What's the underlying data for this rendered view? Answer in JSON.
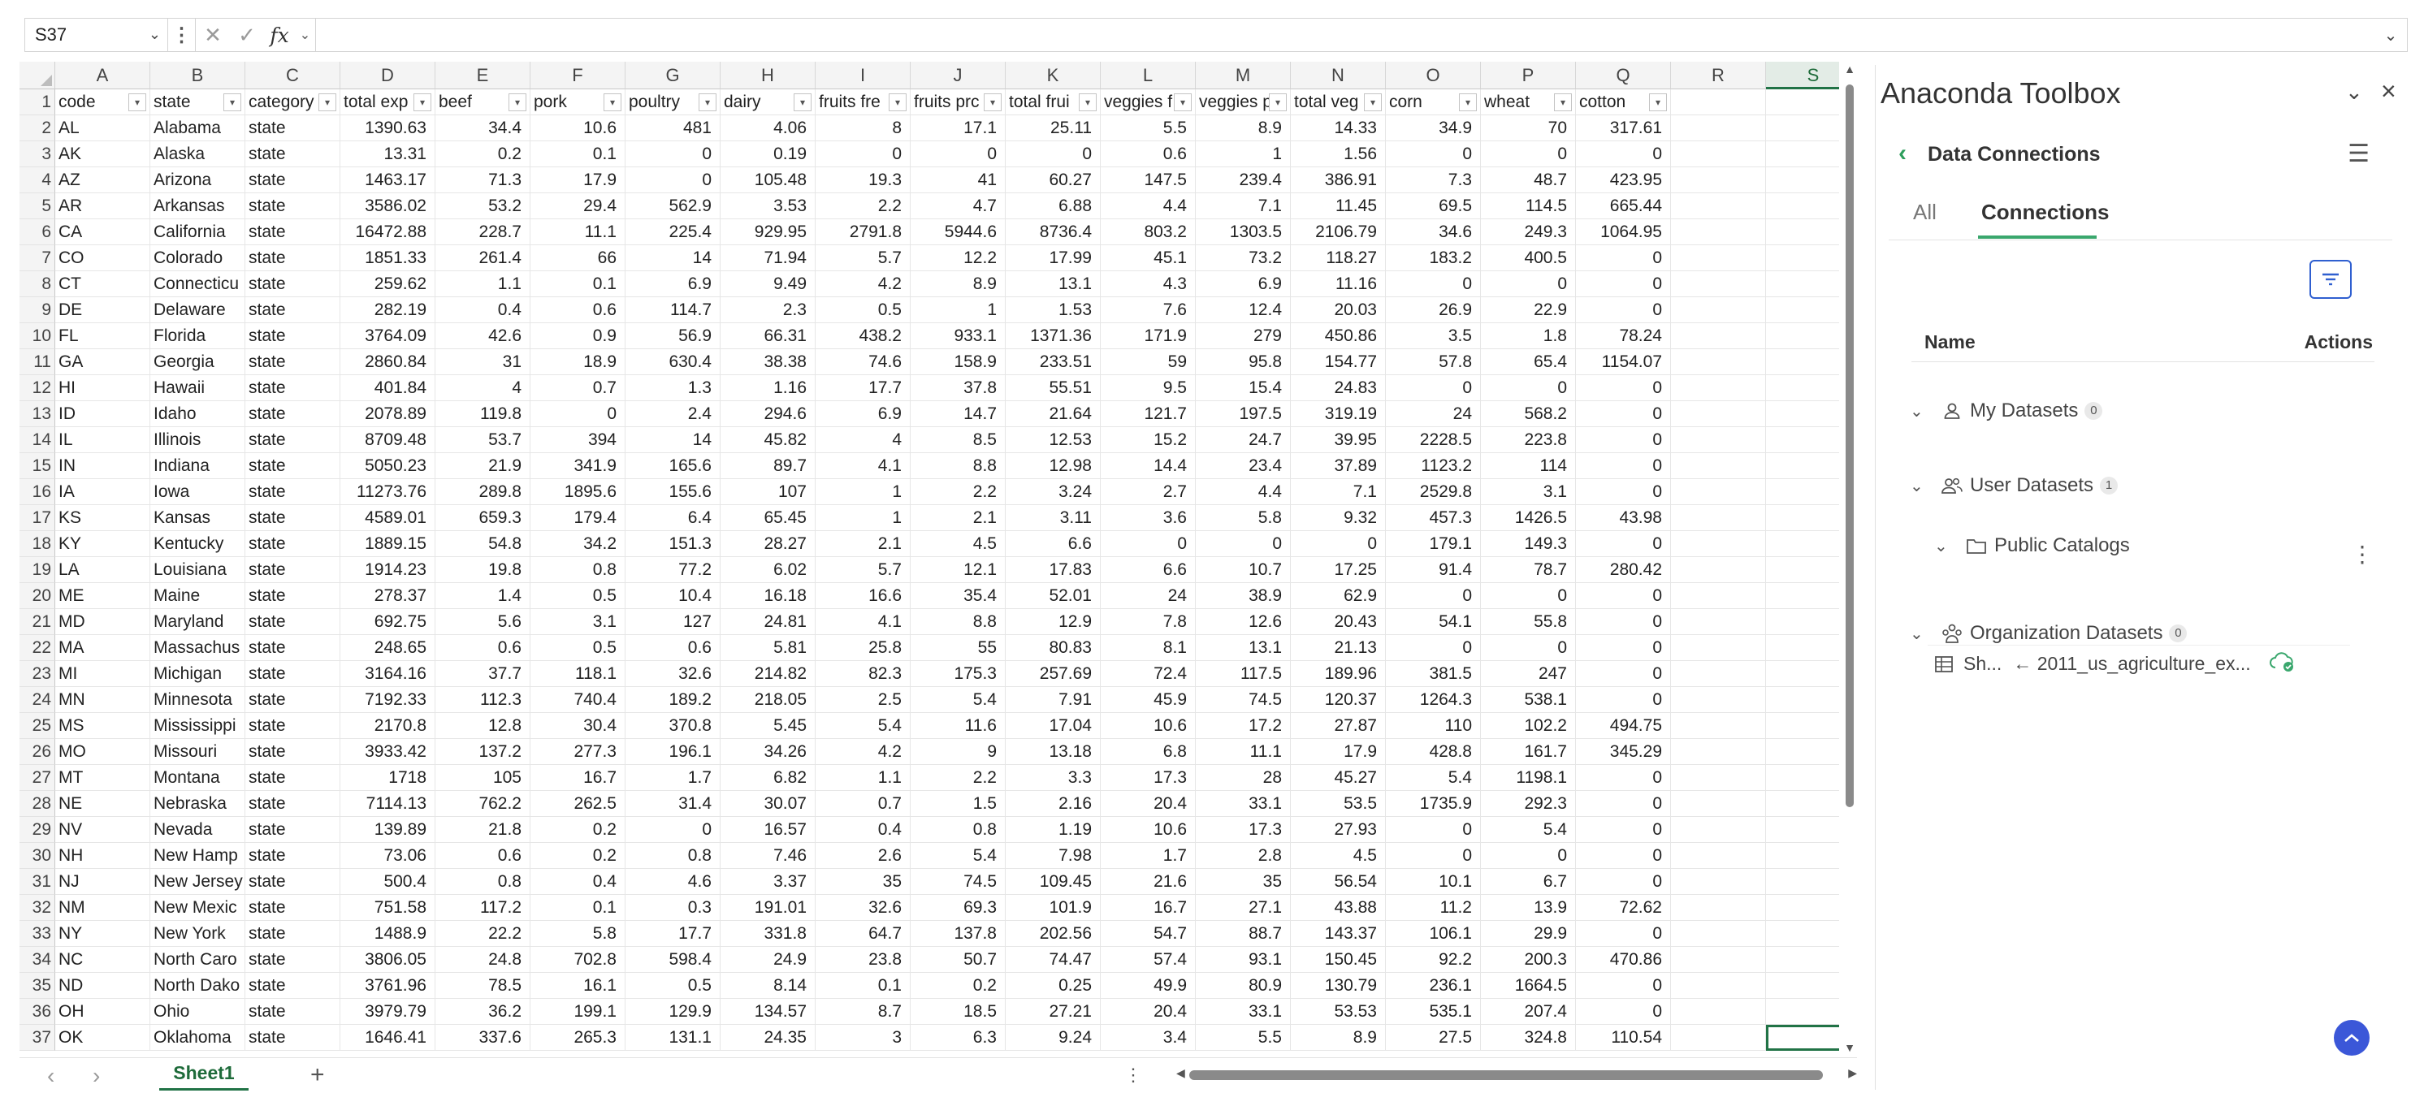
{
  "formula_bar": {
    "name_box": "S37",
    "fx": "fx",
    "content": ""
  },
  "spreadsheet": {
    "column_letters": [
      "A",
      "B",
      "C",
      "D",
      "E",
      "F",
      "G",
      "H",
      "I",
      "J",
      "K",
      "L",
      "M",
      "N",
      "O",
      "P",
      "Q",
      "R",
      "S"
    ],
    "selected_column": "S",
    "selected_cell": "S37",
    "headers": [
      "code",
      "state",
      "category",
      "total exp",
      "beef",
      "pork",
      "poultry",
      "dairy",
      "fruits fre",
      "fruits prc",
      "total frui",
      "veggies f",
      "veggies p",
      "total veg",
      "corn",
      "wheat",
      "cotton"
    ],
    "rows": [
      [
        "2",
        "AL",
        "Alabama",
        "state",
        "1390.63",
        "34.4",
        "10.6",
        "481",
        "4.06",
        "8",
        "17.1",
        "25.11",
        "5.5",
        "8.9",
        "14.33",
        "34.9",
        "70",
        "317.61"
      ],
      [
        "3",
        "AK",
        "Alaska",
        "state",
        "13.31",
        "0.2",
        "0.1",
        "0",
        "0.19",
        "0",
        "0",
        "0",
        "0.6",
        "1",
        "1.56",
        "0",
        "0",
        "0"
      ],
      [
        "4",
        "AZ",
        "Arizona",
        "state",
        "1463.17",
        "71.3",
        "17.9",
        "0",
        "105.48",
        "19.3",
        "41",
        "60.27",
        "147.5",
        "239.4",
        "386.91",
        "7.3",
        "48.7",
        "423.95"
      ],
      [
        "5",
        "AR",
        "Arkansas",
        "state",
        "3586.02",
        "53.2",
        "29.4",
        "562.9",
        "3.53",
        "2.2",
        "4.7",
        "6.88",
        "4.4",
        "7.1",
        "11.45",
        "69.5",
        "114.5",
        "665.44"
      ],
      [
        "6",
        "CA",
        "California",
        "state",
        "16472.88",
        "228.7",
        "11.1",
        "225.4",
        "929.95",
        "2791.8",
        "5944.6",
        "8736.4",
        "803.2",
        "1303.5",
        "2106.79",
        "34.6",
        "249.3",
        "1064.95"
      ],
      [
        "7",
        "CO",
        "Colorado",
        "state",
        "1851.33",
        "261.4",
        "66",
        "14",
        "71.94",
        "5.7",
        "12.2",
        "17.99",
        "45.1",
        "73.2",
        "118.27",
        "183.2",
        "400.5",
        "0"
      ],
      [
        "8",
        "CT",
        "Connecticu",
        "state",
        "259.62",
        "1.1",
        "0.1",
        "6.9",
        "9.49",
        "4.2",
        "8.9",
        "13.1",
        "4.3",
        "6.9",
        "11.16",
        "0",
        "0",
        "0"
      ],
      [
        "9",
        "DE",
        "Delaware",
        "state",
        "282.19",
        "0.4",
        "0.6",
        "114.7",
        "2.3",
        "0.5",
        "1",
        "1.53",
        "7.6",
        "12.4",
        "20.03",
        "26.9",
        "22.9",
        "0"
      ],
      [
        "10",
        "FL",
        "Florida",
        "state",
        "3764.09",
        "42.6",
        "0.9",
        "56.9",
        "66.31",
        "438.2",
        "933.1",
        "1371.36",
        "171.9",
        "279",
        "450.86",
        "3.5",
        "1.8",
        "78.24"
      ],
      [
        "11",
        "GA",
        "Georgia",
        "state",
        "2860.84",
        "31",
        "18.9",
        "630.4",
        "38.38",
        "74.6",
        "158.9",
        "233.51",
        "59",
        "95.8",
        "154.77",
        "57.8",
        "65.4",
        "1154.07"
      ],
      [
        "12",
        "HI",
        "Hawaii",
        "state",
        "401.84",
        "4",
        "0.7",
        "1.3",
        "1.16",
        "17.7",
        "37.8",
        "55.51",
        "9.5",
        "15.4",
        "24.83",
        "0",
        "0",
        "0"
      ],
      [
        "13",
        "ID",
        "Idaho",
        "state",
        "2078.89",
        "119.8",
        "0",
        "2.4",
        "294.6",
        "6.9",
        "14.7",
        "21.64",
        "121.7",
        "197.5",
        "319.19",
        "24",
        "568.2",
        "0"
      ],
      [
        "14",
        "IL",
        "Illinois",
        "state",
        "8709.48",
        "53.7",
        "394",
        "14",
        "45.82",
        "4",
        "8.5",
        "12.53",
        "15.2",
        "24.7",
        "39.95",
        "2228.5",
        "223.8",
        "0"
      ],
      [
        "15",
        "IN",
        "Indiana",
        "state",
        "5050.23",
        "21.9",
        "341.9",
        "165.6",
        "89.7",
        "4.1",
        "8.8",
        "12.98",
        "14.4",
        "23.4",
        "37.89",
        "1123.2",
        "114",
        "0"
      ],
      [
        "16",
        "IA",
        "Iowa",
        "state",
        "11273.76",
        "289.8",
        "1895.6",
        "155.6",
        "107",
        "1",
        "2.2",
        "3.24",
        "2.7",
        "4.4",
        "7.1",
        "2529.8",
        "3.1",
        "0"
      ],
      [
        "17",
        "KS",
        "Kansas",
        "state",
        "4589.01",
        "659.3",
        "179.4",
        "6.4",
        "65.45",
        "1",
        "2.1",
        "3.11",
        "3.6",
        "5.8",
        "9.32",
        "457.3",
        "1426.5",
        "43.98"
      ],
      [
        "18",
        "KY",
        "Kentucky",
        "state",
        "1889.15",
        "54.8",
        "34.2",
        "151.3",
        "28.27",
        "2.1",
        "4.5",
        "6.6",
        "0",
        "0",
        "0",
        "179.1",
        "149.3",
        "0"
      ],
      [
        "19",
        "LA",
        "Louisiana",
        "state",
        "1914.23",
        "19.8",
        "0.8",
        "77.2",
        "6.02",
        "5.7",
        "12.1",
        "17.83",
        "6.6",
        "10.7",
        "17.25",
        "91.4",
        "78.7",
        "280.42"
      ],
      [
        "20",
        "ME",
        "Maine",
        "state",
        "278.37",
        "1.4",
        "0.5",
        "10.4",
        "16.18",
        "16.6",
        "35.4",
        "52.01",
        "24",
        "38.9",
        "62.9",
        "0",
        "0",
        "0"
      ],
      [
        "21",
        "MD",
        "Maryland",
        "state",
        "692.75",
        "5.6",
        "3.1",
        "127",
        "24.81",
        "4.1",
        "8.8",
        "12.9",
        "7.8",
        "12.6",
        "20.43",
        "54.1",
        "55.8",
        "0"
      ],
      [
        "22",
        "MA",
        "Massachus",
        "state",
        "248.65",
        "0.6",
        "0.5",
        "0.6",
        "5.81",
        "25.8",
        "55",
        "80.83",
        "8.1",
        "13.1",
        "21.13",
        "0",
        "0",
        "0"
      ],
      [
        "23",
        "MI",
        "Michigan",
        "state",
        "3164.16",
        "37.7",
        "118.1",
        "32.6",
        "214.82",
        "82.3",
        "175.3",
        "257.69",
        "72.4",
        "117.5",
        "189.96",
        "381.5",
        "247",
        "0"
      ],
      [
        "24",
        "MN",
        "Minnesota",
        "state",
        "7192.33",
        "112.3",
        "740.4",
        "189.2",
        "218.05",
        "2.5",
        "5.4",
        "7.91",
        "45.9",
        "74.5",
        "120.37",
        "1264.3",
        "538.1",
        "0"
      ],
      [
        "25",
        "MS",
        "Mississippi",
        "state",
        "2170.8",
        "12.8",
        "30.4",
        "370.8",
        "5.45",
        "5.4",
        "11.6",
        "17.04",
        "10.6",
        "17.2",
        "27.87",
        "110",
        "102.2",
        "494.75"
      ],
      [
        "26",
        "MO",
        "Missouri",
        "state",
        "3933.42",
        "137.2",
        "277.3",
        "196.1",
        "34.26",
        "4.2",
        "9",
        "13.18",
        "6.8",
        "11.1",
        "17.9",
        "428.8",
        "161.7",
        "345.29"
      ],
      [
        "27",
        "MT",
        "Montana",
        "state",
        "1718",
        "105",
        "16.7",
        "1.7",
        "6.82",
        "1.1",
        "2.2",
        "3.3",
        "17.3",
        "28",
        "45.27",
        "5.4",
        "1198.1",
        "0"
      ],
      [
        "28",
        "NE",
        "Nebraska",
        "state",
        "7114.13",
        "762.2",
        "262.5",
        "31.4",
        "30.07",
        "0.7",
        "1.5",
        "2.16",
        "20.4",
        "33.1",
        "53.5",
        "1735.9",
        "292.3",
        "0"
      ],
      [
        "29",
        "NV",
        "Nevada",
        "state",
        "139.89",
        "21.8",
        "0.2",
        "0",
        "16.57",
        "0.4",
        "0.8",
        "1.19",
        "10.6",
        "17.3",
        "27.93",
        "0",
        "5.4",
        "0"
      ],
      [
        "30",
        "NH",
        "New Hamp",
        "state",
        "73.06",
        "0.6",
        "0.2",
        "0.8",
        "7.46",
        "2.6",
        "5.4",
        "7.98",
        "1.7",
        "2.8",
        "4.5",
        "0",
        "0",
        "0"
      ],
      [
        "31",
        "NJ",
        "New Jersey",
        "state",
        "500.4",
        "0.8",
        "0.4",
        "4.6",
        "3.37",
        "35",
        "74.5",
        "109.45",
        "21.6",
        "35",
        "56.54",
        "10.1",
        "6.7",
        "0"
      ],
      [
        "32",
        "NM",
        "New Mexic",
        "state",
        "751.58",
        "117.2",
        "0.1",
        "0.3",
        "191.01",
        "32.6",
        "69.3",
        "101.9",
        "16.7",
        "27.1",
        "43.88",
        "11.2",
        "13.9",
        "72.62"
      ],
      [
        "33",
        "NY",
        "New York",
        "state",
        "1488.9",
        "22.2",
        "5.8",
        "17.7",
        "331.8",
        "64.7",
        "137.8",
        "202.56",
        "54.7",
        "88.7",
        "143.37",
        "106.1",
        "29.9",
        "0"
      ],
      [
        "34",
        "NC",
        "North Caro",
        "state",
        "3806.05",
        "24.8",
        "702.8",
        "598.4",
        "24.9",
        "23.8",
        "50.7",
        "74.47",
        "57.4",
        "93.1",
        "150.45",
        "92.2",
        "200.3",
        "470.86"
      ],
      [
        "35",
        "ND",
        "North Dako",
        "state",
        "3761.96",
        "78.5",
        "16.1",
        "0.5",
        "8.14",
        "0.1",
        "0.2",
        "0.25",
        "49.9",
        "80.9",
        "130.79",
        "236.1",
        "1664.5",
        "0"
      ],
      [
        "36",
        "OH",
        "Ohio",
        "state",
        "3979.79",
        "36.2",
        "199.1",
        "129.9",
        "134.57",
        "8.7",
        "18.5",
        "27.21",
        "20.4",
        "33.1",
        "53.53",
        "535.1",
        "207.4",
        "0"
      ],
      [
        "37",
        "OK",
        "Oklahoma",
        "state",
        "1646.41",
        "337.6",
        "265.3",
        "131.1",
        "24.35",
        "3",
        "6.3",
        "9.24",
        "3.4",
        "5.5",
        "8.9",
        "27.5",
        "324.8",
        "110.54"
      ]
    ],
    "sheet_tab": "Sheet1"
  },
  "panel": {
    "title": "Anaconda Toolbox",
    "section_title": "Data Connections",
    "tabs": [
      "All",
      "Connections"
    ],
    "active_tab": "Connections",
    "table_headers": {
      "name": "Name",
      "actions": "Actions"
    },
    "groups": [
      {
        "label": "My Datasets",
        "count": "0",
        "icon": "user-icon"
      },
      {
        "label": "User Datasets",
        "count": "1",
        "icon": "users-icon"
      },
      {
        "label": "Organization Datasets",
        "count": "0",
        "icon": "organization-icon"
      }
    ],
    "public_catalogs": "Public Catalogs",
    "dataset_short": "Sh...",
    "dataset_source": "← 2011_us_agriculture_ex...",
    "colors": {
      "accent": "#3aa76d",
      "link_blue": "#3b57d8",
      "excel_green": "#217346"
    }
  }
}
